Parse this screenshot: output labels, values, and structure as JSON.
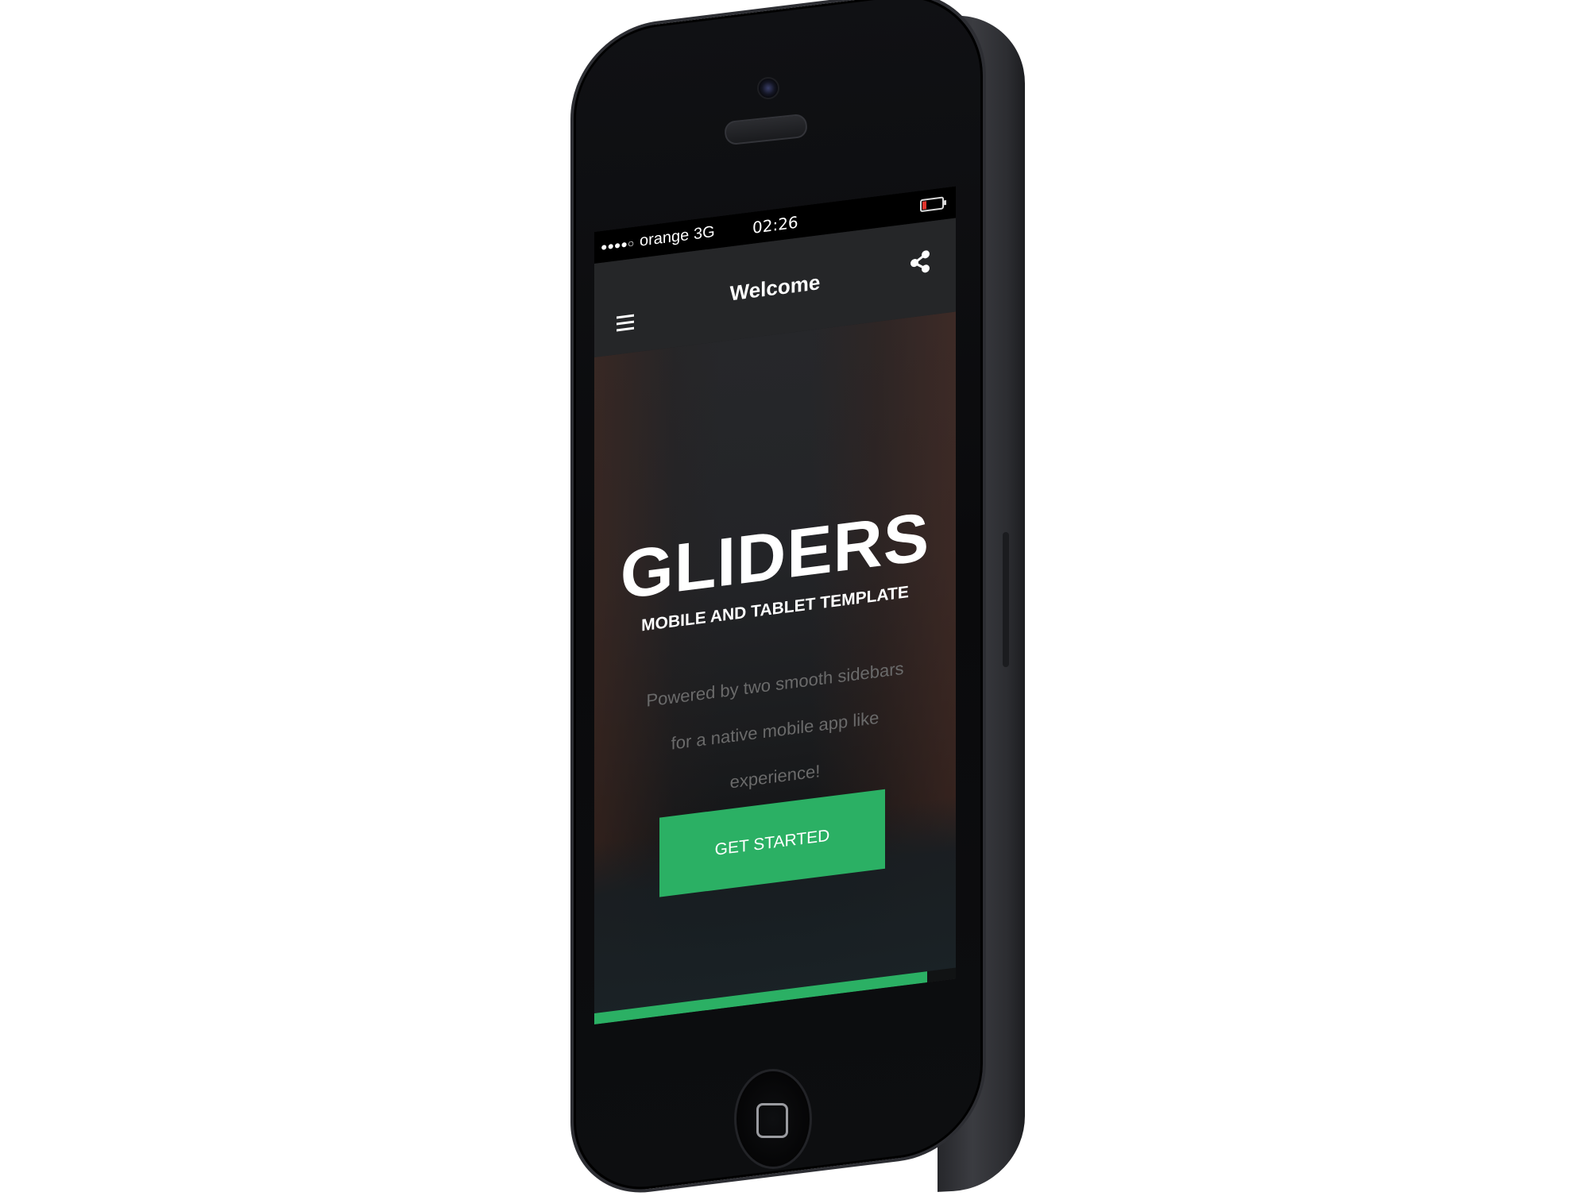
{
  "status_bar": {
    "signal_dots": "●●●●○",
    "carrier": "orange",
    "network": "3G",
    "time": "02:26",
    "battery_level": 0.2,
    "battery_color": "#e0342c"
  },
  "header": {
    "title": "Welcome",
    "menu_icon": "hamburger-icon",
    "share_icon": "share-icon"
  },
  "hero": {
    "title": "GLIDERS",
    "subtitle": "MOBILE AND TABLET TEMPLATE",
    "body": "Powered by two smooth sidebars for a native mobile app like experience!",
    "cta_label": "GET STARTED"
  },
  "progress": {
    "value": 0.92
  },
  "colors": {
    "accent": "#2bb064",
    "header_bg": "#252628",
    "status_bg": "#000000"
  }
}
